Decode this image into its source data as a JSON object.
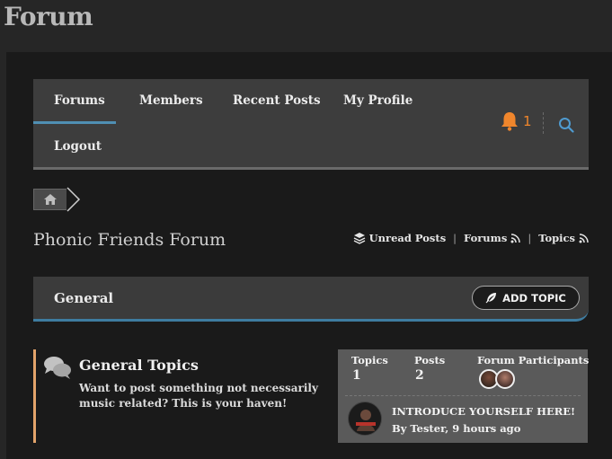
{
  "page": {
    "title": "Forum"
  },
  "nav": {
    "items": [
      {
        "label": "Forums"
      },
      {
        "label": "Members"
      },
      {
        "label": "Recent Posts"
      },
      {
        "label": "My Profile"
      },
      {
        "label": "Logout"
      }
    ],
    "notification_count": "1",
    "accent": "#4f8fb3",
    "bell_color": "#f0862c",
    "icons": {
      "notifications": "bell-icon",
      "search": "search-icon"
    }
  },
  "breadcrumb": {
    "home_icon": "home-icon"
  },
  "forum": {
    "name": "Phonic Friends Forum",
    "links": [
      {
        "label": "Unread Posts"
      },
      {
        "label": "Forums"
      },
      {
        "label": "Topics"
      }
    ]
  },
  "section": {
    "title": "General",
    "add_topic_label": "ADD TOPIC"
  },
  "topic_group": {
    "title": "General Topics",
    "description": "Want to post something not necessarily music related? This is your haven!",
    "border_color": "#e2a36a",
    "stats": {
      "topics_label": "Topics",
      "topics_value": "1",
      "posts_label": "Posts",
      "posts_value": "2",
      "participants_label": "Forum Participants"
    },
    "last_post": {
      "title": "INTRODUCE YOURSELF HERE!",
      "by": "By Tester, 9 hours ago"
    }
  }
}
